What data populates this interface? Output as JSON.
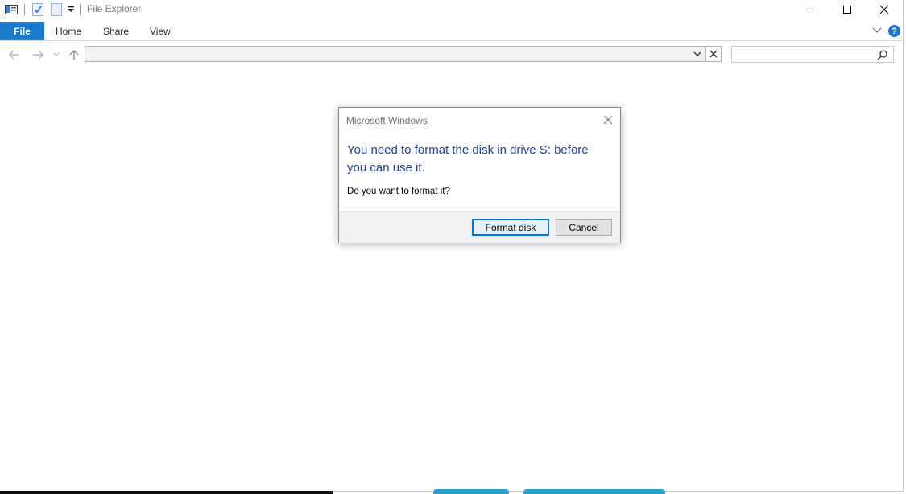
{
  "window": {
    "title": "File Explorer"
  },
  "ribbon": {
    "tabs": [
      {
        "label": "File"
      },
      {
        "label": "Home"
      },
      {
        "label": "Share"
      },
      {
        "label": "View"
      }
    ],
    "help_label": "?"
  },
  "address": {
    "value": ""
  },
  "search": {
    "placeholder": ""
  },
  "dialog": {
    "title": "Microsoft Windows",
    "main_line1": "You need to format the disk in drive S: before",
    "main_line2": "you can use it.",
    "question": "Do you want to format it?",
    "buttons": {
      "format": "Format disk",
      "cancel": "Cancel"
    }
  },
  "colors": {
    "accent": "#1979ca",
    "dialog_heading": "#1e3f9b",
    "default_button_border": "#0078d7"
  },
  "icons": [
    "properties-icon",
    "checkmark-icon",
    "new-folder-icon",
    "dropdown-icon",
    "minimize-icon",
    "maximize-icon",
    "close-icon",
    "ribbon-collapse-icon",
    "help-icon",
    "back-arrow-icon",
    "forward-arrow-icon",
    "recent-dropdown-icon",
    "up-arrow-icon",
    "address-dropdown-icon",
    "address-clear-icon",
    "search-icon",
    "dialog-close-icon"
  ]
}
